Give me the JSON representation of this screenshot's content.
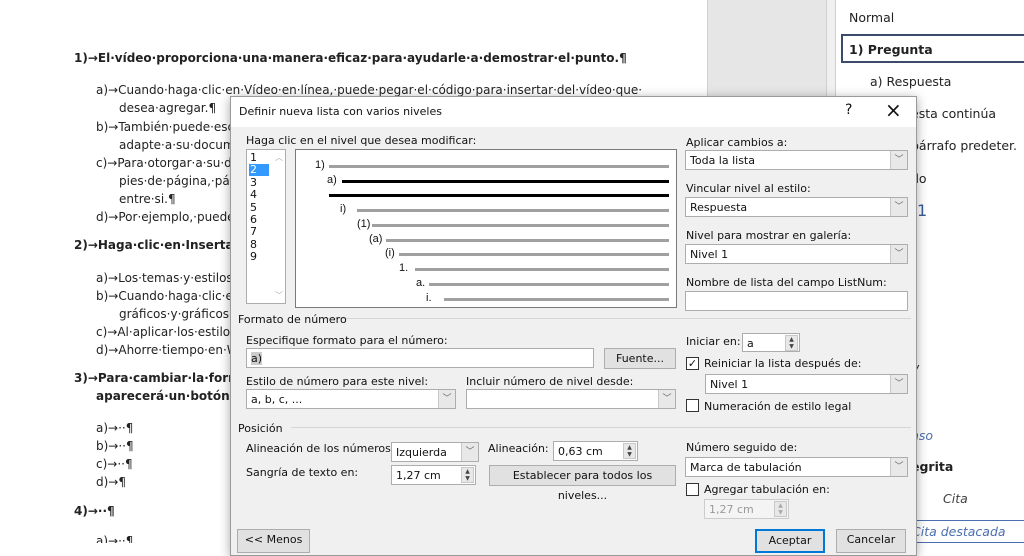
{
  "document": {
    "lines": [
      {
        "text": "1)→El·vídeo·proporciona·una·manera·eficaz·para·ayudarle·a·demostrar·el·punto.¶",
        "bold": true
      },
      {
        "text": "a)→Cuando·haga·clic·en·Vídeo·en·línea,·puede·pegar·el·código·para·insertar·del·vídeo·que·"
      },
      {
        "text": "desea·agregar.¶"
      },
      {
        "text": "b)→También·puede·escr"
      },
      {
        "text": "adapte·a·su·docume"
      },
      {
        "text": "c)→Para·otorgar·a·su·do"
      },
      {
        "text": "pies·de·página,·págir"
      },
      {
        "text": "entre·si.¶"
      },
      {
        "text": "d)→Por·ejemplo,·puede·"
      },
      {
        "text": "2)→Haga·clic·en·Insertar·y·e",
        "bold": true
      },
      {
        "text": "a)→Los·temas·y·estilos·t"
      },
      {
        "text": "b)→Cuando·haga·clic·en"
      },
      {
        "text": "gráficos·y·gráficos·Sr"
      },
      {
        "text": "c)→Al·aplicar·los·estilos,"
      },
      {
        "text": "d)→Ahorre·tiempo·en·W"
      },
      {
        "text": "3)→Para·cambiar·la·forma·e",
        "bold": true
      },
      {
        "text": "aparecerá·un·botón·de·",
        "bold": true
      },
      {
        "text": "a)→··¶"
      },
      {
        "text": "b)→··¶"
      },
      {
        "text": "c)→··¶"
      },
      {
        "text": "d)→¶"
      },
      {
        "text": "4)→··¶",
        "bold": true
      },
      {
        "text": "a)→··¶"
      }
    ]
  },
  "styles_pane": {
    "items": [
      "Normal",
      "1) Pregunta",
      "a) Respuesta",
      "esta continúa",
      "párrafo predeter.",
      "do",
      "1",
      "/",
      "nso",
      "egrita",
      "Cita",
      "Cita destacada"
    ],
    "selected": "1) Pregunta"
  },
  "dialog": {
    "title": "Definir nueva lista con varios niveles",
    "help": "?",
    "close": "×",
    "level_label": "Haga clic en el nivel que desea modificar:",
    "levels": [
      "1",
      "2",
      "3",
      "4",
      "5",
      "6",
      "7",
      "8",
      "9"
    ],
    "selected_level": "2",
    "preview": [
      "1)",
      "a)",
      "i)",
      "(1)",
      "(a)",
      "(i)",
      "1.",
      "a.",
      "i."
    ],
    "apply_label": "Aplicar cambios a:",
    "apply_value": "Toda la lista",
    "link_label": "Vincular nivel al estilo:",
    "link_value": "Respuesta",
    "gallery_label": "Nivel para mostrar en galería:",
    "gallery_value": "Nivel 1",
    "listnum_label": "Nombre de lista del campo ListNum:",
    "listnum_value": "",
    "number_format_section": "Formato de número",
    "format_label": "Especifique formato para el número:",
    "format_value": "a)",
    "font_button": "Fuente...",
    "style_label": "Estilo de número para este nivel:",
    "style_value": "a, b, c, ...",
    "include_label": "Incluir número de nivel desde:",
    "include_value": "",
    "start_label": "Iniciar en:",
    "start_value": "a",
    "restart_label": "Reiniciar la lista después de:",
    "restart_checked": true,
    "restart_value": "Nivel 1",
    "legal_label": "Numeración de estilo legal",
    "legal_checked": false,
    "position_section": "Posición",
    "align_label": "Alineación de los números:",
    "align_value": "Izquierda",
    "at_label": "Alineación:",
    "at_value": "0,63 cm",
    "indent_label": "Sangría de texto en:",
    "indent_value": "1,27 cm",
    "set_all_button": "Establecer para todos los niveles...",
    "follow_label": "Número seguido de:",
    "follow_value": "Marca de tabulación",
    "tab_label": "Agregar tabulación en:",
    "tab_checked": false,
    "tab_value": "1,27 cm",
    "less_button": "<< Menos",
    "ok_button": "Aceptar",
    "cancel_button": "Cancelar"
  }
}
